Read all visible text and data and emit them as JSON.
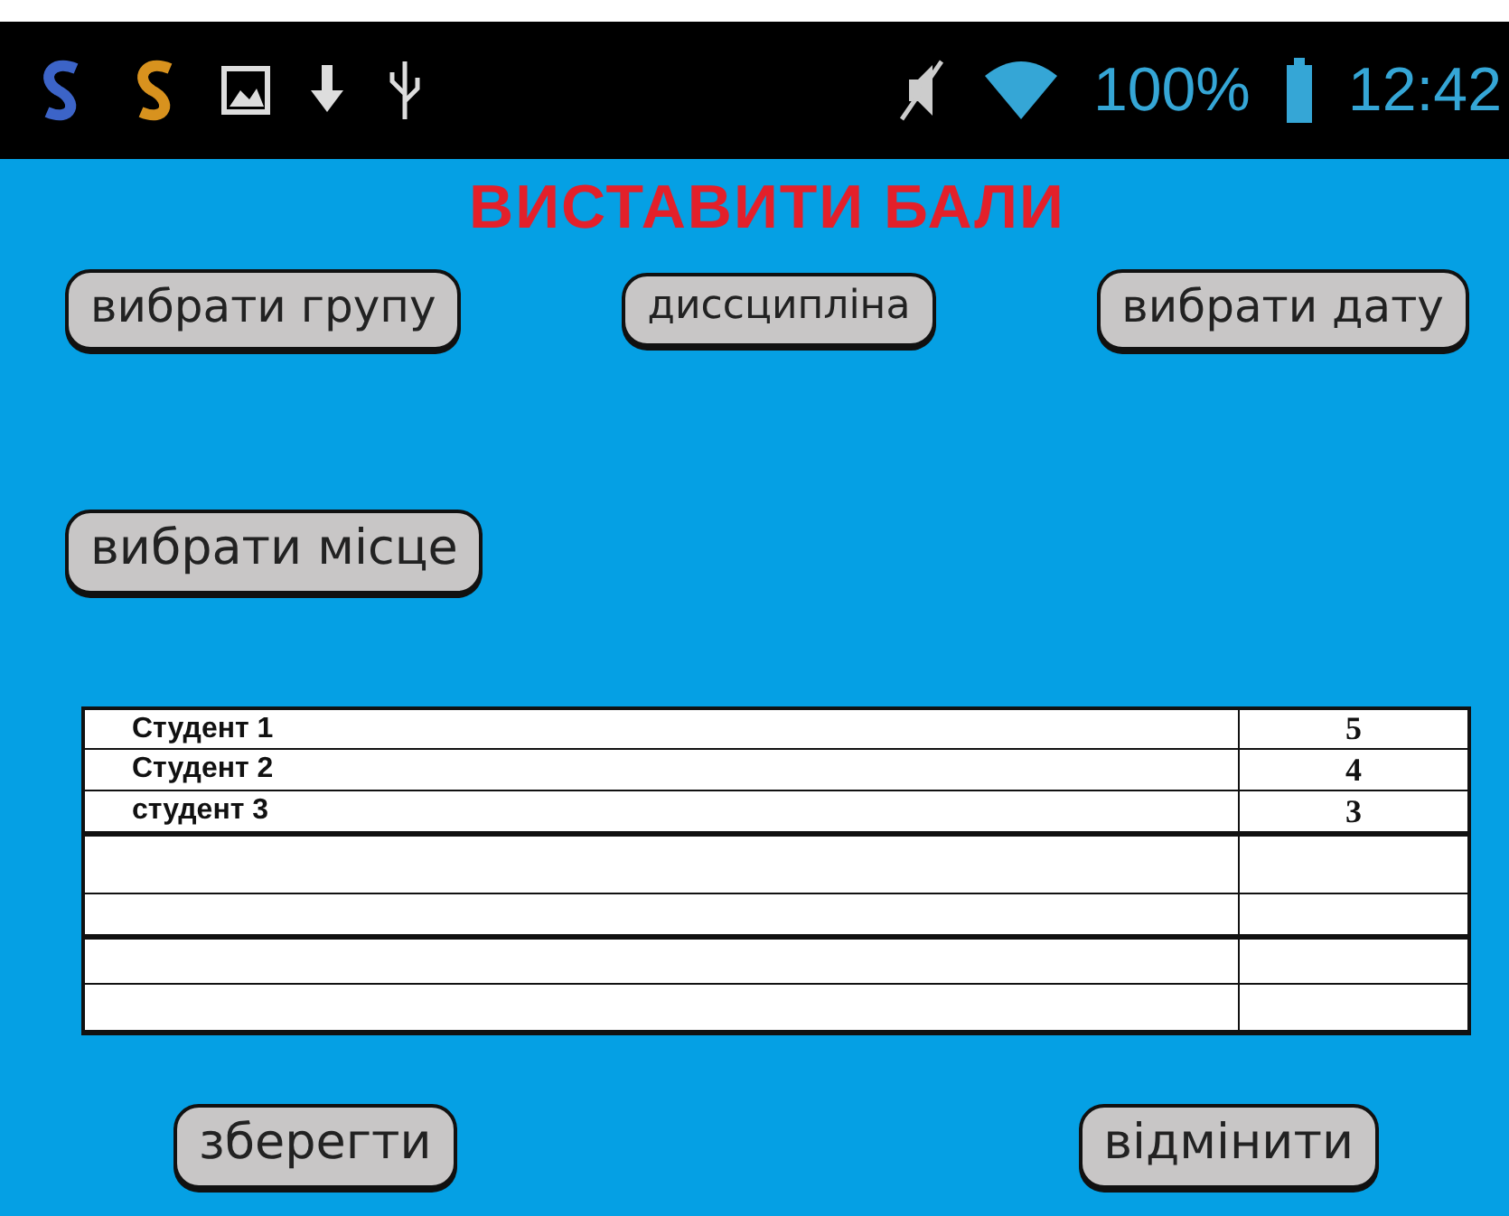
{
  "status_bar": {
    "battery": "100%",
    "time": "12:42"
  },
  "title": "ВИСТАВИТИ БАЛИ",
  "top_buttons": [
    "вибрати групу",
    "диссципліна",
    "вибрати дату"
  ],
  "place_button": "вибрати місце",
  "table": {
    "rows": [
      {
        "name": "Студент 1",
        "score": "5"
      },
      {
        "name": "Студент 2",
        "score": "4"
      },
      {
        "name": "студент 3",
        "score": "3"
      }
    ]
  },
  "bottom_buttons": [
    "зберегти",
    "відмінити"
  ]
}
